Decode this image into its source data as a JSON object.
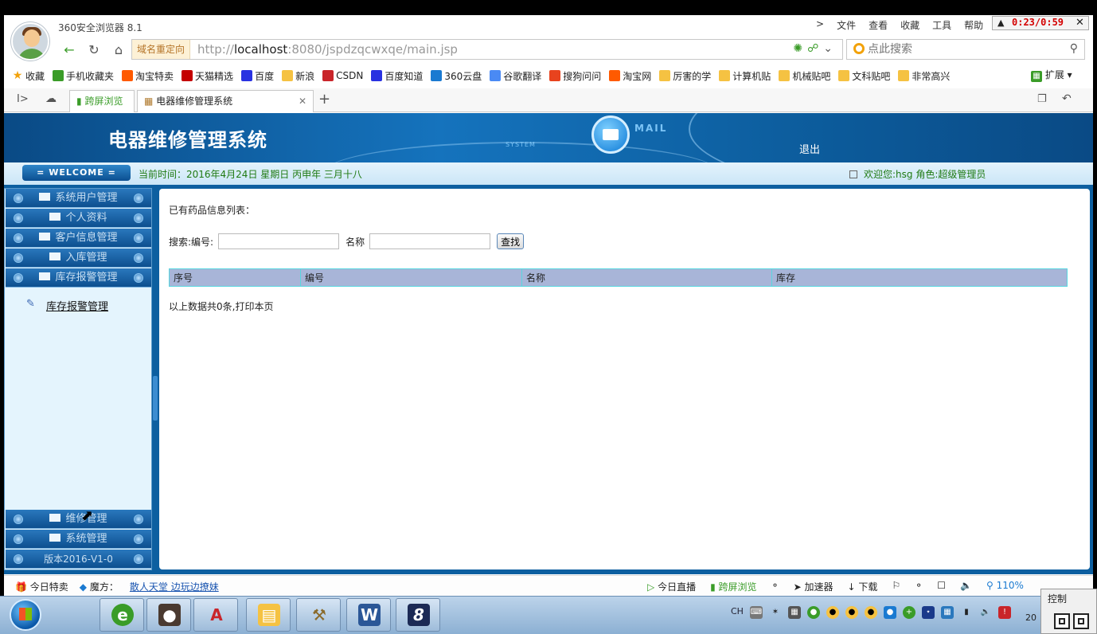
{
  "browser": {
    "title": "360安全浏览器 8.1",
    "menu": [
      "文件",
      "查看",
      "收藏",
      "工具",
      "帮助"
    ],
    "timer": "0:23/0:59",
    "redirect_label": "域名重定向",
    "url_prefix": "http://",
    "url_host": "localhost",
    "url_rest": ":8080/jspdzqcwxqe/main.jsp",
    "search_placeholder": "点此搜索",
    "favorites": [
      {
        "label": "收藏",
        "icon": "star-icon",
        "color": "#f2a20b"
      },
      {
        "label": "手机收藏夹",
        "icon": "phone-icon",
        "color": "#3a9c28"
      },
      {
        "label": "淘宝特卖",
        "icon": "taobao-icon",
        "color": "#ff5a00"
      },
      {
        "label": "天猫精选",
        "icon": "tmall-icon",
        "color": "#c40000"
      },
      {
        "label": "百度",
        "icon": "baidu-icon",
        "color": "#2932e1"
      },
      {
        "label": "新浪",
        "icon": "folder-icon",
        "color": "#f5c242"
      },
      {
        "label": "CSDN",
        "icon": "csdn-icon",
        "color": "#c9252a"
      },
      {
        "label": "百度知道",
        "icon": "baidu-icon",
        "color": "#2932e1"
      },
      {
        "label": "360云盘",
        "icon": "cloud-icon",
        "color": "#1a7ad1"
      },
      {
        "label": "谷歌翻译",
        "icon": "translate-icon",
        "color": "#4a8af4"
      },
      {
        "label": "搜狗问问",
        "icon": "sogou-icon",
        "color": "#e8431e"
      },
      {
        "label": "淘宝网",
        "icon": "taobao-icon",
        "color": "#ff5a00"
      },
      {
        "label": "厉害的学",
        "icon": "folder-icon",
        "color": "#f5c242"
      },
      {
        "label": "计算机贴",
        "icon": "folder-icon",
        "color": "#f5c242"
      },
      {
        "label": "机械贴吧",
        "icon": "folder-icon",
        "color": "#f5c242"
      },
      {
        "label": "文科贴吧",
        "icon": "folder-icon",
        "color": "#f5c242"
      },
      {
        "label": "非常高兴",
        "icon": "folder-icon",
        "color": "#f5c242"
      }
    ],
    "extensions_label": "扩展",
    "tabs": {
      "cross_screen": "跨屏浏览",
      "active": "电器维修管理系统"
    }
  },
  "app": {
    "title": "电器维修管理系统",
    "mail_word": "MAIL",
    "system_word": "SYSTEM",
    "logout": "退出",
    "welcome": "= WELCOME =",
    "current_time": "当前时间：2016年4月24日 星期日 丙申年 三月十八",
    "user_info": "欢迎您:hsg 角色:超级管理员",
    "menu_top": [
      "系统用户管理",
      "个人资料",
      "客户信息管理",
      "入库管理",
      "库存报警管理"
    ],
    "submenu_link": "库存报警管理",
    "menu_bottom": [
      "维修管理",
      "系统管理",
      "版本2016-V1-0"
    ],
    "main": {
      "list_title": "已有药品信息列表：",
      "search_label": "搜索:编号:",
      "name_label": "名称",
      "find_button": "查找",
      "columns": [
        "序号",
        "编号",
        "名称",
        "库存"
      ],
      "summary": "以上数据共0条,打印本页"
    }
  },
  "statusbar": {
    "today_deals": "今日特卖",
    "magic_label": "魔方：",
    "magic_link": "散人天堂 边玩边撩妹",
    "live": "今日直播",
    "cross_screen": "跨屏浏览",
    "accelerator": "加速器",
    "download": "下载",
    "zoom": "110%"
  },
  "taskbar": {
    "lang": "CH",
    "control_label": "控制",
    "clock": "20"
  }
}
